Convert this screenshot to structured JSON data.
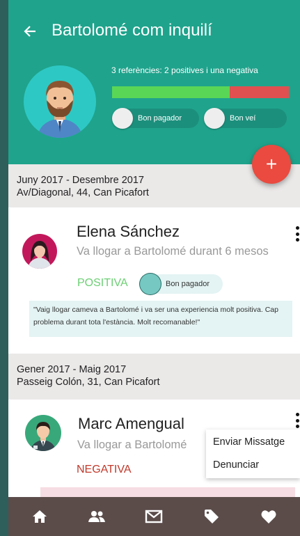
{
  "header": {
    "title": "Bartolomé com inquilí",
    "references": "3 referències: 2 positives i una negativa",
    "positive_fraction": 0.667,
    "colors": {
      "bg": "#1fa38c",
      "positive": "#5ad656",
      "negative": "#e05050"
    },
    "chips": [
      {
        "label": "Bon pagador",
        "on": false
      },
      {
        "label": "Bon veí",
        "on": false
      }
    ]
  },
  "fab": {
    "label": "+",
    "color": "#ea4a3f"
  },
  "reviews": [
    {
      "period": "Juny 2017 - Desembre 2017",
      "address": "Av/Diagonal, 44, Can Picafort",
      "name": "Elena Sánchez",
      "subtitle": "Va llogar a Bartolomé durant 6 mesos",
      "verdict": "POSITIVA",
      "verdict_color": "#6ccf74",
      "tag": "Bon pagador",
      "quote": "\"Vaig llogar cameva a Bartolomé i va ser una experiencia molt positiva. Cap problema durant tota l'estància. Molt recomanable!\""
    },
    {
      "period": "Gener 2017 - Maig 2017",
      "address": "Passeig Colón, 31, Can Picafort",
      "name": "Marc Amengual",
      "subtitle": "Va llogar a Bartolomé",
      "verdict": "NEGATIVA",
      "verdict_color": "#c0392b"
    }
  ],
  "context_menu": {
    "items": [
      "Enviar Missatge",
      "Denunciar"
    ]
  },
  "bottom_nav": {
    "items": [
      "home-icon",
      "people-icon",
      "mail-icon",
      "tag-icon",
      "heart-icon"
    ],
    "color": "#5b4c4a"
  }
}
